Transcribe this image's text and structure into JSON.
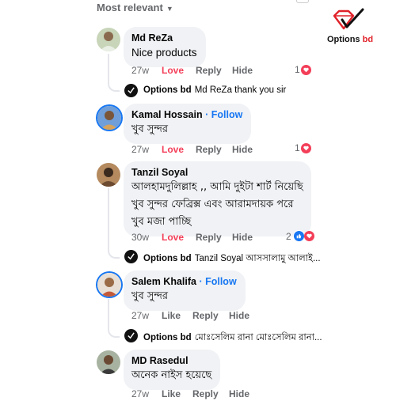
{
  "header": {
    "sort_label": "Most relevant"
  },
  "brand": {
    "name": "Options",
    "suffix": "bd"
  },
  "comments": [
    {
      "name": "Md ReZa",
      "follow": "",
      "text": "Nice products",
      "time": "27w",
      "love": "Love",
      "reply": "Reply",
      "hide": "Hide",
      "reaction_count": "1",
      "reply_preview": {
        "author": "Options bd",
        "text": "Md ReZa thank you sir"
      }
    },
    {
      "name": "Kamal Hossain",
      "follow": " · Follow",
      "text": "খুব সুন্দর",
      "time": "27w",
      "love": "Love",
      "reply": "Reply",
      "hide": "Hide",
      "reaction_count": "1"
    },
    {
      "name": "Tanzil Soyal",
      "follow": "",
      "text_lines": [
        "আলহামদুলিল্লাহ ,, আমি দুইটা শার্ট নিয়েছি",
        "খুব সুন্দর ফেব্রিক্স এবং আরামদায়ক পরে",
        "খুব মজা পাচ্ছি"
      ],
      "time": "30w",
      "love": "Love",
      "reply": "Reply",
      "hide": "Hide",
      "reaction_count": "2",
      "reply_preview": {
        "author": "Options bd",
        "text": "Tanzil Soyal আসসালামু আলাই..."
      }
    },
    {
      "name": "Salem Khalifa",
      "follow": " · Follow",
      "text": "খুব সুন্দর",
      "time": "27w",
      "like": "Like",
      "reply": "Reply",
      "hide": "Hide",
      "reply_preview": {
        "author": "Options bd",
        "text": "মোঃসেলিম রানা মোঃসেলিম রানা..."
      }
    },
    {
      "name": "MD Rasedul",
      "follow": "",
      "text": "অনেক নাইস হয়েছে",
      "time": "27w",
      "like": "Like",
      "reply": "Reply",
      "hide": "Hide"
    }
  ],
  "colors": {
    "accent": "#1877f2",
    "love": "#f33e58",
    "muted": "#65676b",
    "bubble": "#f0f2f5"
  }
}
